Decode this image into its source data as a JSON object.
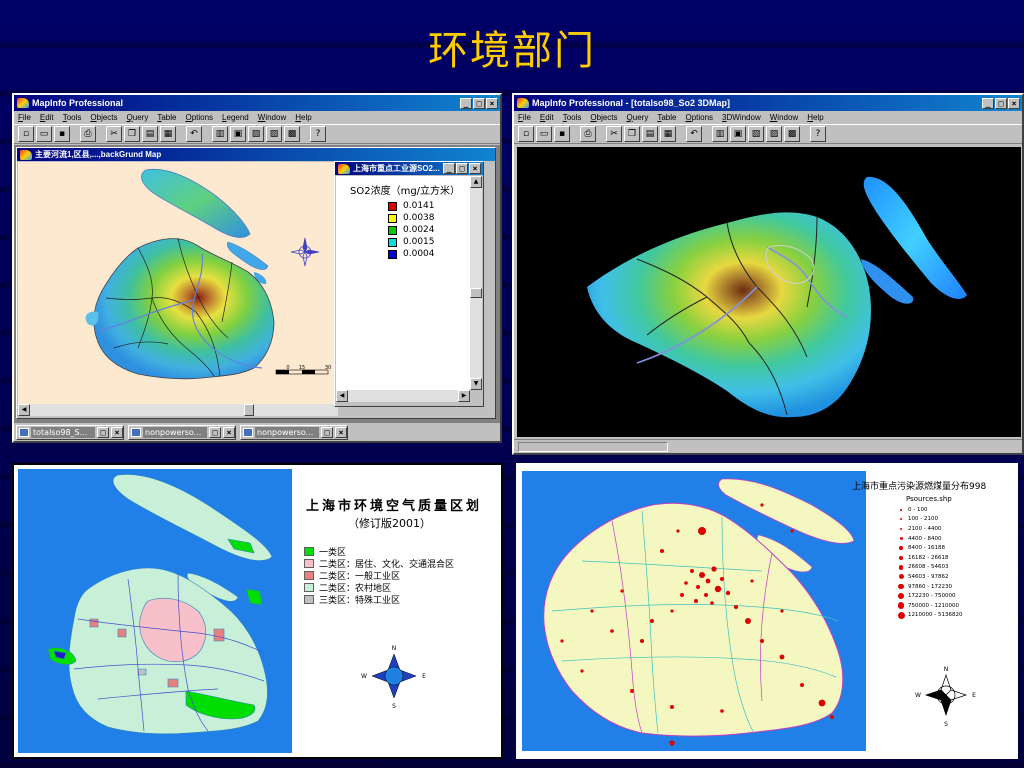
{
  "slide": {
    "title": "环境部门"
  },
  "colors": {
    "title": "#ffcc00",
    "so2_1": "#e00000",
    "so2_2": "#ffff00",
    "so2_3": "#00cc00",
    "so2_4": "#00e0e0",
    "so2_5": "#0000e0"
  },
  "window_left": {
    "title": "MapInfo Professional",
    "menu": [
      "File",
      "Edit",
      "Tools",
      "Objects",
      "Query",
      "Table",
      "Options",
      "Legend",
      "Window",
      "Help"
    ],
    "map_child_title": "主要河流1,区县,...,backGrund Map",
    "legend_child_title": "上海市重点工业源SO2...",
    "legend": {
      "title": "SO2浓度（mg/立方米）",
      "items": [
        {
          "label": "0.0141",
          "color": "#e00000"
        },
        {
          "label": "0.0038",
          "color": "#ffff00"
        },
        {
          "label": "0.0024",
          "color": "#00cc00"
        },
        {
          "label": "0.0015",
          "color": "#00e0e0"
        },
        {
          "label": "0.0004",
          "color": "#0000e0"
        }
      ]
    },
    "scalebar": {
      "ticks": [
        "0",
        "15",
        "30"
      ]
    },
    "tasks": [
      "totalso98_S...",
      "nonpowerso...",
      "nonpowerso..."
    ]
  },
  "window_right": {
    "title": "MapInfo Professional - [totalso98_So2 3DMap]",
    "menu": [
      "File",
      "Edit",
      "Tools",
      "Objects",
      "Query",
      "Table",
      "Options",
      "3DWindow",
      "Window",
      "Help"
    ]
  },
  "zone_map": {
    "title": "上海市环境空气质量区划",
    "subtitle": "（修订版2001）",
    "legend": [
      {
        "label": "一类区",
        "color": "#00dd00"
      },
      {
        "label": "二类区：居住、文化、交通混合区",
        "color": "#f8c0c8"
      },
      {
        "label": "二类区：一般工业区",
        "color": "#e88080"
      },
      {
        "label": "二类区：农村地区",
        "color": "#c8f0d8"
      },
      {
        "label": "三类区：特殊工业区",
        "color": "#c0c0c0"
      }
    ],
    "compass": {
      "n": "N",
      "s": "S",
      "e": "E",
      "w": "W"
    }
  },
  "pollution_map": {
    "title": "上海市重点污染源燃煤量分布998",
    "source": "Psources.shp",
    "legend": [
      "0 - 100",
      "100 - 2100",
      "2100 - 4400",
      "4400 - 8400",
      "8400 - 16188",
      "16182 - 26618",
      "26608 - 54603",
      "54603 - 97862",
      "97860 - 172230",
      "172230 - 750000",
      "750000 - 1210000",
      "1210000 - 5136820"
    ],
    "compass": {
      "n": "N",
      "s": "S",
      "e": "E",
      "w": "W"
    }
  }
}
